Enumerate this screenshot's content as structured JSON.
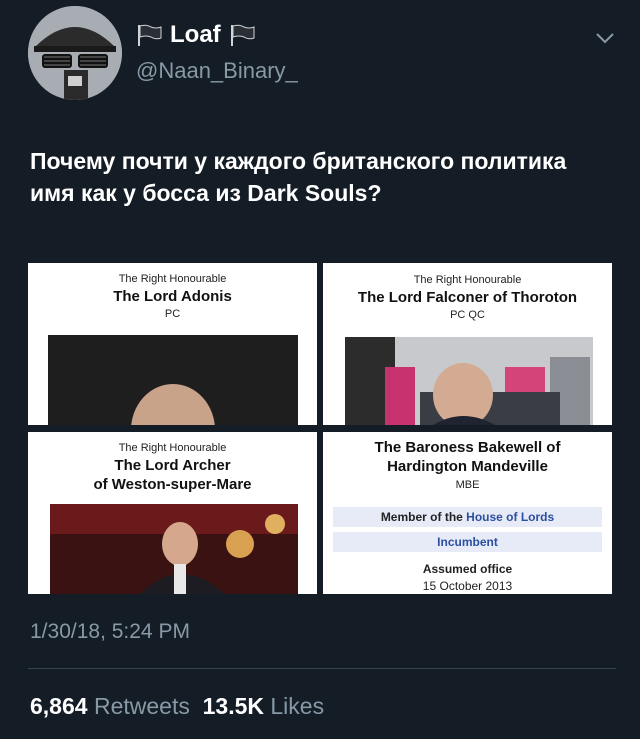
{
  "user": {
    "display_name": "Loaf",
    "handle": "@Naan_Binary_"
  },
  "tweet": {
    "text": "Почему почти у каждого британского политика имя как у босса из Dark Souls?",
    "timestamp": "1/30/18, 5:24 PM",
    "retweets_count": "6,864",
    "retweets_label": "Retweets",
    "likes_count": "13.5K",
    "likes_label": "Likes"
  },
  "media": {
    "card1": {
      "pre": "The Right Honourable",
      "title": "The Lord Adonis",
      "sub": "PC"
    },
    "card2": {
      "pre": "The Right Honourable",
      "title": "The Lord Falconer of Thoroton",
      "sub": "PC QC"
    },
    "card3": {
      "pre": "The Right Honourable",
      "title_line1": "The Lord Archer",
      "title_line2": "of Weston-super-Mare"
    },
    "card4": {
      "title_line1": "The Baroness Bakewell of",
      "title_line2": "Hardington Mandeville",
      "sub": "MBE",
      "member_prefix": "Member of the",
      "member_link": "House of Lords",
      "incumbent": "Incumbent",
      "assumed": "Assumed office",
      "date": "15 October 2013"
    }
  },
  "icons": {
    "flag": "black-flag-icon",
    "chevron": "chevron-down-icon"
  },
  "colors": {
    "background": "#141d26",
    "secondary_text": "#8899a6",
    "link_blue": "#2b4fa1"
  }
}
